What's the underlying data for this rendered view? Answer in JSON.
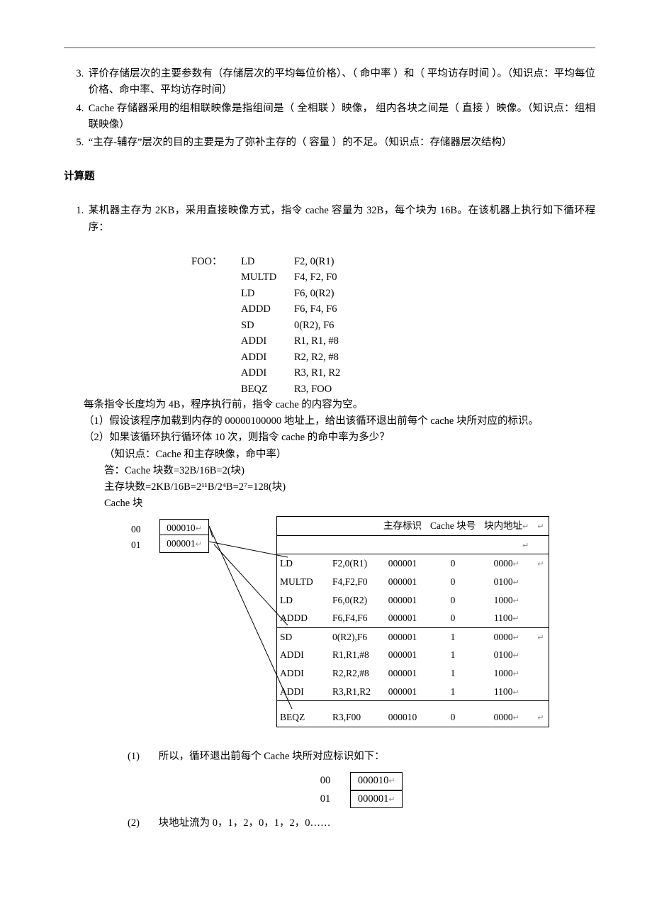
{
  "fill": {
    "q3": "评价存储层次的主要参数有（存储层次的平均每位价格）、（  命中率          ）和（  平均访存时间          ）。（知识点：平均每位价格、命中率、平均访存时间）",
    "q4": "Cache 存储器采用的组相联映像是指组间是（    全相联    ）映像，  组内各块之间是（   直接      ）映像。（知识点：组相联映像）",
    "q5": "“主存-辅存”层次的目的主要是为了弥补主存的（  容量    ）的不足。（知识点：存储器层次结构）"
  },
  "section_title": "计算题",
  "calc": {
    "stem": "某机器主存为 2KB，采用直接映像方式，指令 cache 容量为 32B，每个块为 16B。在该机器上执行如下循环程序：",
    "code": [
      [
        "FOO：",
        "LD",
        "F2, 0(R1)"
      ],
      [
        "",
        "MULTD",
        "F4, F2, F0"
      ],
      [
        "",
        "LD",
        "F6, 0(R2)"
      ],
      [
        "",
        "ADDD",
        "F6, F4, F6"
      ],
      [
        "",
        "SD",
        "0(R2), F6"
      ],
      [
        "",
        "ADDI",
        "R1, R1, #8"
      ],
      [
        "",
        "ADDI",
        "R2, R2, #8"
      ],
      [
        "",
        "ADDI",
        "R3, R1, R2"
      ],
      [
        "",
        "BEQZ",
        "R3, FOO"
      ]
    ],
    "after_code": "每条指令长度均为 4B，程序执行前，指令 cache 的内容为空。",
    "sub1": "（1）假设该程序加载到内存的 00000100000 地址上，给出该循环退出前每个 cache 块所对应的标识。",
    "sub2": "（2）如果该循环执行循环体 10 次，则指令 cache 的命中率为多少？",
    "hint": "（知识点：Cache 和主存映像，命中率）",
    "a1": "答：Cache 块数=32B/16B=2(块)",
    "a2": "主存块数=2KB/16B=2¹¹B/2⁴B=2⁷=128(块)",
    "a3": "Cache 块"
  },
  "diagram": {
    "cache_rows": [
      {
        "idx": "00",
        "tag": "000010"
      },
      {
        "idx": "01",
        "tag": "000001"
      }
    ],
    "headers": [
      "",
      "",
      "主存标识",
      "Cache 块号",
      "块内地址"
    ],
    "rows": [
      {
        "op": "LD",
        "args": "F2,0(R1)",
        "tag": "000001",
        "blk": "0",
        "off": "0000",
        "sep": false,
        "arrow": true
      },
      {
        "op": "MULTD",
        "args": "F4,F2,F0",
        "tag": "000001",
        "blk": "0",
        "off": "0100",
        "sep": false,
        "arrow": false
      },
      {
        "op": "LD",
        "args": "F6,0(R2)",
        "tag": "000001",
        "blk": "0",
        "off": "1000",
        "sep": false,
        "arrow": false
      },
      {
        "op": "ADDD",
        "args": "F6,F4,F6",
        "tag": "000001",
        "blk": "0",
        "off": "1100",
        "sep": true,
        "arrow": false
      },
      {
        "op": "SD",
        "args": "0(R2),F6",
        "tag": "000001",
        "blk": "1",
        "off": "0000",
        "sep": false,
        "arrow": true
      },
      {
        "op": "ADDI",
        "args": "R1,R1,#8",
        "tag": "000001",
        "blk": "1",
        "off": "0100",
        "sep": false,
        "arrow": false
      },
      {
        "op": "ADDI",
        "args": "R2,R2,#8",
        "tag": "000001",
        "blk": "1",
        "off": "1000",
        "sep": false,
        "arrow": false
      },
      {
        "op": "ADDI",
        "args": "R3,R1,R2",
        "tag": "000001",
        "blk": "1",
        "off": "1100",
        "sep": true,
        "arrow": false
      },
      {
        "op": "BEQZ",
        "args": "R3,F00",
        "tag": "000010",
        "blk": "0",
        "off": "0000",
        "sep": false,
        "arrow": true
      }
    ]
  },
  "answer1": {
    "lead": "所以，循环退出前每个 Cache 块所对应标识如下：",
    "rows": [
      {
        "idx": "00",
        "tag": "000010"
      },
      {
        "idx": "01",
        "tag": "000001"
      }
    ]
  },
  "answer2": "块地址流为 0，1，2，0，1，2，0……",
  "labels": {
    "p1": "(1)",
    "p2": "(2)"
  }
}
